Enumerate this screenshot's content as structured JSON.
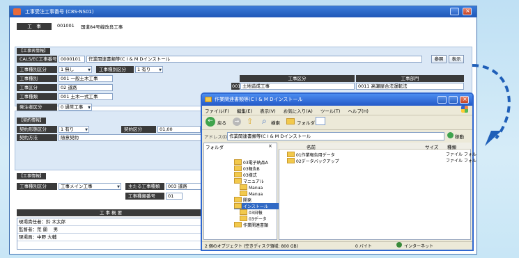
{
  "main": {
    "title": "工事受注工事番号 (C8S-NS01)",
    "header_label": "工　事",
    "header_code": "001001",
    "header_name": "国道84号線改良工事",
    "sec1": "【工事名情報】",
    "row1_label": "CALS/EC工事番号",
    "row1_code": "0000101",
    "row1_value": "作業関連書類等(C I & M Dインストール",
    "ref_button": "参照",
    "open_button": "表示",
    "row2_label": "工事種別区分",
    "row2_value": "1 無し",
    "row2b_label": "工事種別区分",
    "row2b_value": "1 有り",
    "row3_label": "工事種別",
    "row3_value": "001 一般土木工事",
    "row4_label": "工事区分",
    "row4_value": "02 道路",
    "row5_label": "工事種類",
    "row5_value": "001 土木一式工事",
    "row6_label": "発注者区分",
    "row6_value": "0 通常工事",
    "table_head1": "工事区分",
    "table_head2": "工事部門",
    "table_row1_code": "001",
    "table_row1_name": "土地造成工事",
    "table_row1_c2": "0011 高瀬屋合法運転法",
    "sec2": "【契約情報】",
    "row7_label": "契約形態区分",
    "row7_value": "1 有り",
    "row7b_label": "契約区分",
    "row7b_value": "01,00",
    "row8_label": "契約方法",
    "row8_value": "随意契約",
    "sec3": "【工事情報】",
    "row9_label": "工事種別区分",
    "row9_value": "工事メイン工事",
    "row9b_label": "主たる工事種類",
    "row9b_value": "003 道路",
    "row10_label": "工事種類番号",
    "row10_value": "01",
    "summary_header": "工 事 概 要",
    "people": [
      "現場責任者：鈴 木太郎",
      "監督者：荒 蘭　 男",
      "現場員：中野 大輔"
    ]
  },
  "explorer": {
    "title": "作業関連書類等(C I & M Dインストール",
    "menu": [
      "ファイル(F)",
      "編集(E)",
      "表示(V)",
      "お気に入り(A)",
      "ツール(T)",
      "ヘルプ(H)"
    ],
    "back_label": "戻る",
    "search_label": "検索",
    "folder_label": "フォルダ",
    "address_label": "アドレス(D)",
    "address_value": "作業関連書類等(C I & M Dインストール",
    "go_label": "移動",
    "tree_header": "フォルダ",
    "col_name": "名前",
    "col_size": "サイズ",
    "col_type": "種類",
    "tree": [
      "03電子納品A",
      "03報告B",
      "03様式",
      "マニュアル",
      "Manua",
      "Manua",
      "開発",
      "インストール",
      "03日報",
      "03データ",
      "作業関連書類"
    ],
    "files": [
      "01作業報告用データ",
      "02データバックアップ"
    ],
    "file_types": [
      "ファイル フォル",
      "ファイル フォル"
    ],
    "status_left": "2 個のオブジェクト (空きディスク領域: 800 GB)",
    "status_mid": "0 バイト",
    "status_right": "インターネット"
  },
  "colors": {
    "accent": "#2459c8",
    "arrow": "#1f5fb8",
    "section": "#dbe8f6"
  },
  "icons": [
    "back-arrow-icon",
    "forward-arrow-icon",
    "up-folder-icon",
    "search-icon",
    "folders-icon",
    "views-icon",
    "go-arrow-icon",
    "windows-flag-icon",
    "folder-icon",
    "internet-icon"
  ]
}
